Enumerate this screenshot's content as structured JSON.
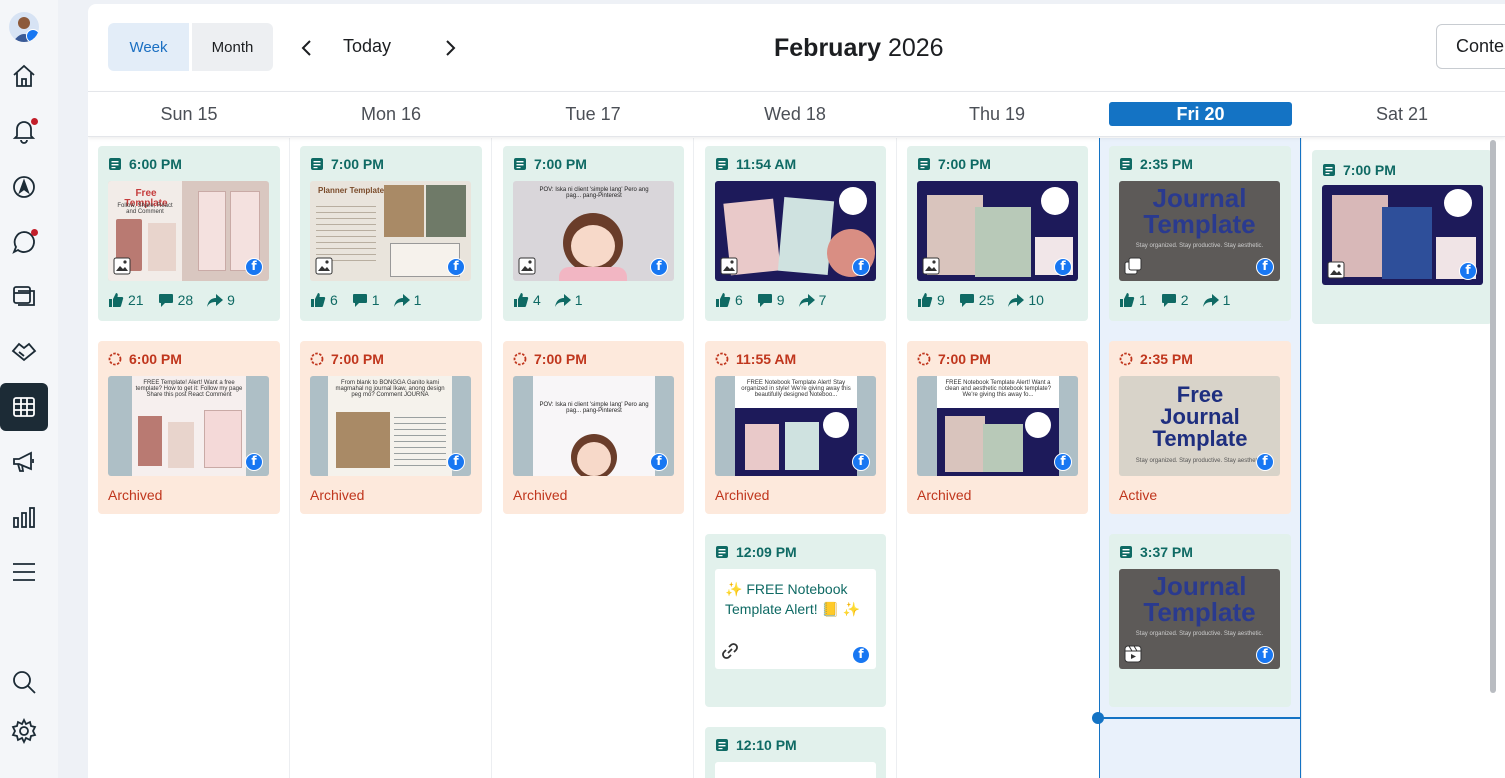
{
  "header": {
    "view_week": "Week",
    "view_month": "Month",
    "today": "Today",
    "month_name": "February",
    "year": "2026",
    "content_button": "Conte"
  },
  "days": [
    "Sun 15",
    "Mon 16",
    "Tue 17",
    "Wed 18",
    "Thu 19",
    "Fri 20",
    "Sat 21"
  ],
  "today_label": "Fri 20",
  "icons": {
    "rail": [
      "home-icon",
      "bell-icon",
      "compass-icon",
      "chat-icon",
      "pages-icon",
      "handshake-icon",
      "calendar-grid-icon",
      "megaphone-icon",
      "bar-chart-icon",
      "menu-icon",
      "search-icon",
      "gear-icon"
    ],
    "post_type": "feed-post-icon",
    "platform": "facebook-icon"
  },
  "colors": {
    "accent": "#1473c4",
    "published_bg": "#e2f1ec",
    "published_text": "#0f6a64",
    "story_bg": "#fde9dc",
    "story_text": "#c0361d",
    "notification": "#c21e2a"
  },
  "posts": {
    "sun": {
      "time": "6:00 PM",
      "likes": "21",
      "comments": "28",
      "shares": "9",
      "thumb_title": "Free Template",
      "thumb_sub": "Follow, Share, React and Comment"
    },
    "mon": {
      "time": "7:00 PM",
      "likes": "6",
      "comments": "1",
      "shares": "1",
      "thumb_title": "Planner Template"
    },
    "tue": {
      "time": "7:00 PM",
      "likes": "4",
      "shares": "1",
      "thumb_text": "POV: Iska ni client 'simple lang' Pero ang pag... pang-Pinterest"
    },
    "wed": {
      "time": "11:54 AM",
      "likes": "6",
      "comments": "9",
      "shares": "7"
    },
    "thu": {
      "time": "7:00 PM",
      "likes": "9",
      "comments": "25",
      "shares": "10"
    },
    "fri": {
      "time": "2:35 PM",
      "likes": "1",
      "comments": "2",
      "shares": "1",
      "thumb_title": "Journal Template",
      "thumb_sub": "Stay organized. Stay productive. Stay aesthetic."
    },
    "sat": {
      "time": "7:00 PM"
    }
  },
  "stories": {
    "sun": {
      "time": "6:00 PM",
      "status": "Archived",
      "caption": "FREE Template! Alert! Want a free template? How to get it: Follow my page Share this post React Comment"
    },
    "mon": {
      "time": "7:00 PM",
      "status": "Archived",
      "caption": "From blank to BONGGA Ganito kami magmahal ng journal Ikaw, anong design peg mo? Comment JOURNA"
    },
    "tue": {
      "time": "7:00 PM",
      "status": "Archived",
      "caption": "POV: Iska ni client 'simple lang' Pero ang pag... pang-Pinterest"
    },
    "wed": {
      "time": "11:55 AM",
      "status": "Archived",
      "caption": "FREE Notebook Template Alert! Stay organized in style! We're giving away this beautifully designed Noteboo..."
    },
    "thu": {
      "time": "7:00 PM",
      "status": "Archived",
      "caption": "FREE Notebook Template Alert! Want a clean and aesthetic notebook template? We're giving this away fo..."
    },
    "fri": {
      "time": "2:35 PM",
      "status": "Active",
      "thumb_title": "Free Journal Template",
      "thumb_sub": "Stay organized. Stay productive. Stay aesthetic."
    }
  },
  "extra_posts": {
    "wed_1": {
      "time": "12:09 PM",
      "text": "✨ FREE Notebook Template Alert! 📒 ✨"
    },
    "wed_2": {
      "time": "12:10 PM"
    },
    "fri_2": {
      "time": "3:37 PM",
      "thumb_title": "Journal Template",
      "thumb_sub": "Stay organized. Stay productive. Stay aesthetic."
    }
  }
}
